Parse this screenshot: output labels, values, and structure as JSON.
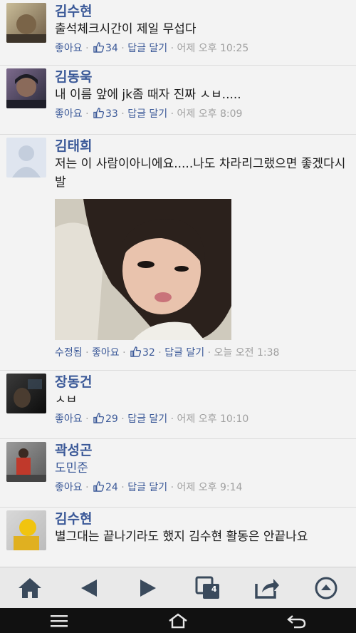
{
  "comments": [
    {
      "name": "김수현",
      "text": "출석체크시간이 제일 무섭다",
      "like_label": "좋아요",
      "like_count": "34",
      "reply_label": "답글 달기",
      "time": "어제 오후 10:25",
      "avatar_colors": [
        "#b9ad8e",
        "#5a4a3a"
      ]
    },
    {
      "name": "김동욱",
      "text": "내 이름 앞에 jk좀 때자 진짜 ㅅㅂ.....",
      "like_label": "좋아요",
      "like_count": "33",
      "reply_label": "답글 달기",
      "time": "어제 오후 8:09",
      "avatar_colors": [
        "#6b5b7c",
        "#2a2a3a"
      ]
    },
    {
      "name": "김태희",
      "text": "저는 이 사람이아니에요.....나도 차라리그랬으면 좋겠다시발",
      "edited_label": "수정됨",
      "like_label": "좋아요",
      "like_count": "32",
      "reply_label": "답글 달기",
      "time": "오늘 오전 1:38",
      "avatar_colors": [
        "#dce3ee",
        "#c3cddd"
      ]
    },
    {
      "name": "장동건",
      "text": "ㅅㅂ",
      "like_label": "좋아요",
      "like_count": "29",
      "reply_label": "답글 달기",
      "time": "어제 오후 10:10",
      "avatar_colors": [
        "#2a2a2a",
        "#0e0e0e"
      ]
    },
    {
      "name": "곽성곤",
      "text": "도민준",
      "like_label": "좋아요",
      "like_count": "24",
      "reply_label": "답글 달기",
      "time": "어제 오후 9:14",
      "avatar_colors": [
        "#c0392b",
        "#444444"
      ]
    },
    {
      "name": "김수현",
      "text": "별그대는 끝나기라도 했지 김수현 활동은 안끝나요",
      "avatar_colors": [
        "#f1c40f",
        "#bdbdbd"
      ]
    }
  ],
  "toolbar": {
    "icons": [
      "home-icon",
      "back-icon",
      "forward-icon",
      "tabs-icon",
      "share-icon",
      "scroll-top-icon"
    ],
    "tab_count": "4",
    "icon_color": "#3a4a5c"
  },
  "navbar": {
    "icons": [
      "menu-icon",
      "home-outline-icon",
      "return-icon"
    ]
  },
  "colors": {
    "link": "#3b5998",
    "muted": "#a0a0a0",
    "background": "#f3f3f3"
  }
}
